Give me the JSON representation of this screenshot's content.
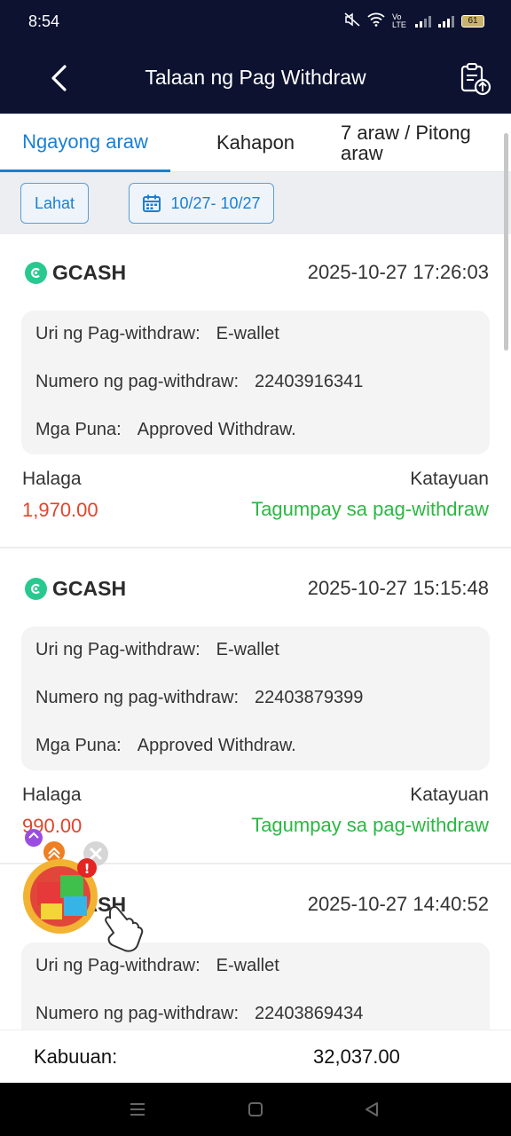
{
  "status_bar": {
    "time": "8:54",
    "network": "Vo LTE",
    "battery": "61"
  },
  "header": {
    "title": "Talaan ng Pag Withdraw"
  },
  "tabs": [
    {
      "label": "Ngayong araw",
      "active": true
    },
    {
      "label": "Kahapon",
      "active": false
    },
    {
      "label": "7 araw / Pitong araw",
      "active": false
    }
  ],
  "filters": {
    "all_label": "Lahat",
    "date_range": "10/27- 10/27"
  },
  "labels": {
    "type": "Uri ng Pag-withdraw",
    "number": "Numero ng pag-withdraw",
    "remarks": "Mga Puna",
    "separator": ":",
    "amount": "Halaga",
    "status": "Katayuan"
  },
  "records": [
    {
      "method": "GCASH",
      "datetime": "2025-10-27 17:26:03",
      "type": "E-wallet",
      "number": "22403916341",
      "remarks": "Approved Withdraw.",
      "amount": "1,970.00",
      "status": "Tagumpay sa pag-withdraw"
    },
    {
      "method": "GCASH",
      "datetime": "2025-10-27 15:15:48",
      "type": "E-wallet",
      "number": "22403879399",
      "remarks": "Approved Withdraw.",
      "amount": "990.00",
      "status": "Tagumpay sa pag-withdraw"
    },
    {
      "method": "GCASH",
      "datetime": "2025-10-27 14:40:52",
      "type": "E-wallet",
      "number": "22403869434",
      "remarks": "",
      "amount": "",
      "status": ""
    }
  ],
  "total": {
    "label": "Kabuuan:",
    "value": "32,037.00"
  },
  "colors": {
    "header_bg": "#0c1230",
    "accent": "#1a7fd4",
    "amount": "#e0452b",
    "success": "#2bb843",
    "gcash": "#28c990"
  },
  "icons": {
    "back": "chevron-left-icon",
    "export": "clipboard-upload-icon",
    "calendar": "calendar-icon",
    "gcash": "gcash-logo-icon"
  }
}
